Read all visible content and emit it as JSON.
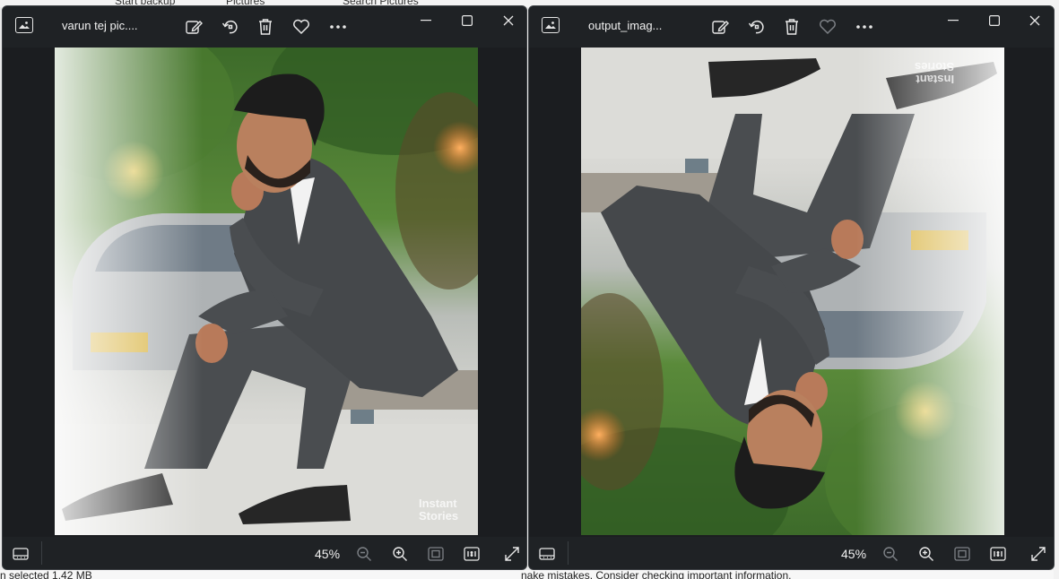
{
  "background": {
    "top_fragments": [
      "Start backup",
      "Pictures",
      "Search Pictures"
    ],
    "bottom_left": "n selected  1.42 MB",
    "bottom_right": "nake mistakes. Consider checking important information."
  },
  "windows": [
    {
      "title": "varun tej pic....",
      "zoom": "45%",
      "orientation": "upright",
      "favorite": false,
      "watermark": [
        "Instant",
        "Stories"
      ]
    },
    {
      "title": "output_imag...",
      "zoom": "45%",
      "orientation": "rotated-180",
      "favorite": false,
      "watermark": [
        "Instant",
        "Stories"
      ]
    }
  ],
  "toolbar_icons": [
    "edit-icon",
    "rotate-icon",
    "delete-icon",
    "favorite-icon",
    "more-icon"
  ],
  "bottombar_icons": [
    "filmstrip-icon",
    "zoom-out-icon",
    "zoom-in-icon",
    "fit-window-icon",
    "actual-size-icon",
    "fullscreen-icon"
  ],
  "colors": {
    "window_bg": "#1f2225",
    "canvas_bg": "#1b1d20",
    "icon": "#e8e8e8",
    "suit": "#4a4d50"
  }
}
